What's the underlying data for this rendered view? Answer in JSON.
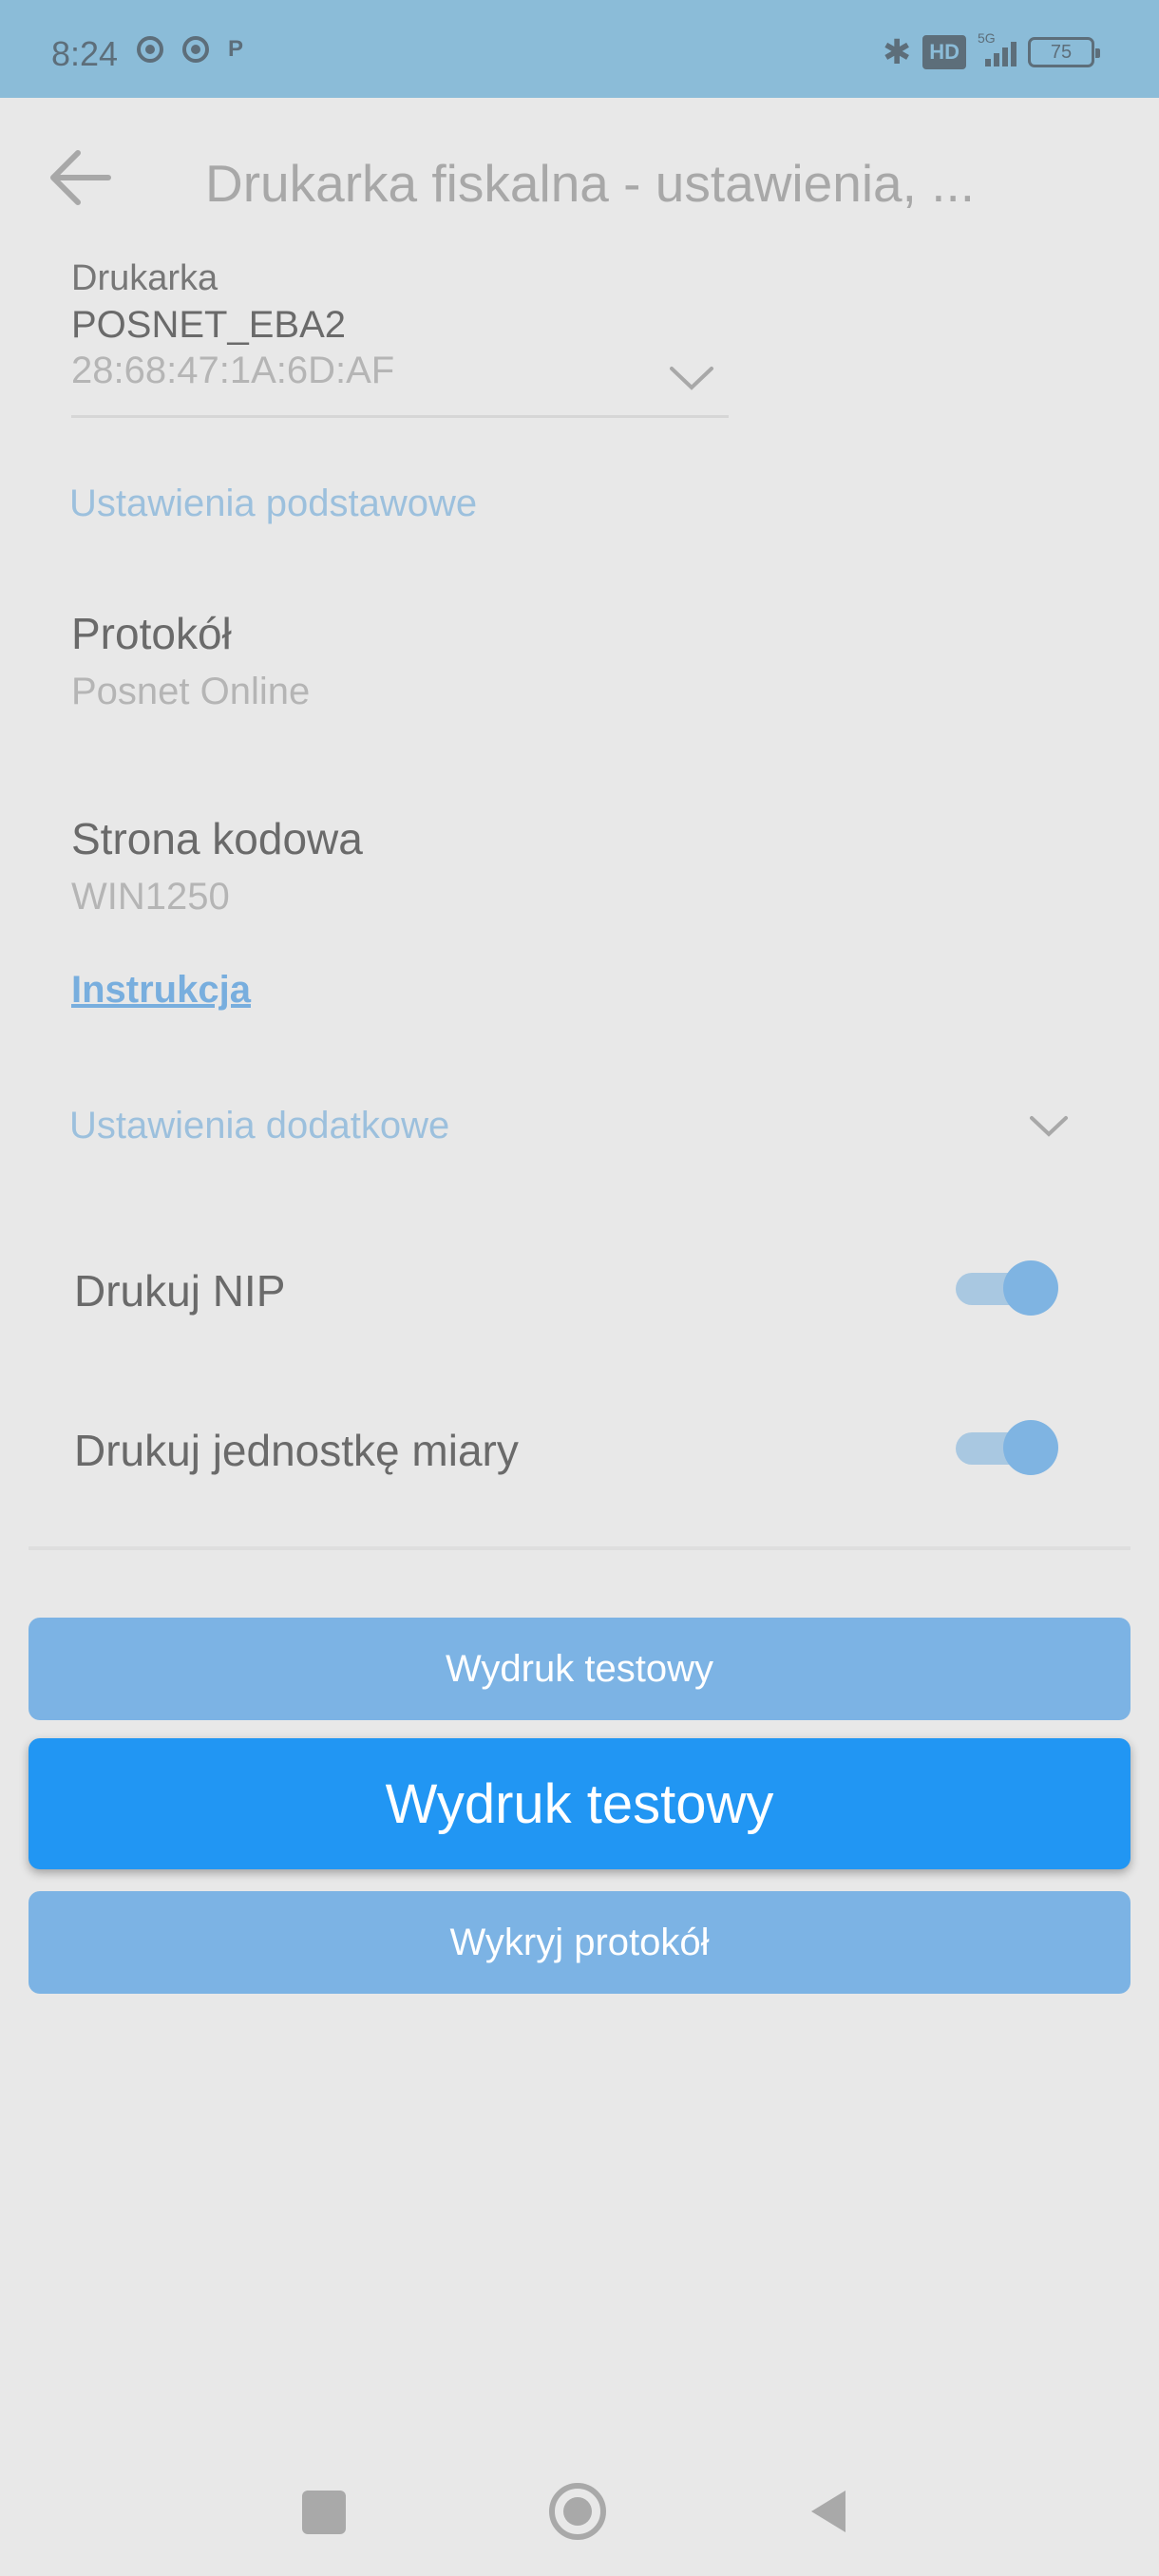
{
  "status_bar": {
    "time": "8:24",
    "network_label": "5G",
    "hd_label": "HD",
    "battery_level": "75"
  },
  "app_bar": {
    "title": "Drukarka fiskalna - ustawienia, ..."
  },
  "printer": {
    "label": "Drukarka",
    "name": "POSNET_EBA2",
    "mac": "28:68:47:1A:6D:AF"
  },
  "basic_settings": {
    "header": "Ustawienia podstawowe",
    "protocol": {
      "title": "Protokół",
      "value": "Posnet Online"
    },
    "code_page": {
      "title": "Strona kodowa",
      "value": "WIN1250"
    },
    "instructions_link": "Instrukcja"
  },
  "additional_settings": {
    "header": "Ustawienia dodatkowe",
    "toggles": [
      {
        "label": "Drukuj NIP",
        "on": true
      },
      {
        "label": "Drukuj jednostkę miary",
        "on": true
      }
    ]
  },
  "buttons": {
    "test_print_faded": "Wydruk testowy",
    "test_print_main": "Wydruk testowy",
    "detect_protocol": "Wykryj protokół"
  },
  "colors": {
    "status_bar": "#8bbcd8",
    "background": "#e8e8e8",
    "accent": "#2196f3",
    "accent_faded": "#7cb3e4",
    "section_header": "#9cc0dd"
  }
}
